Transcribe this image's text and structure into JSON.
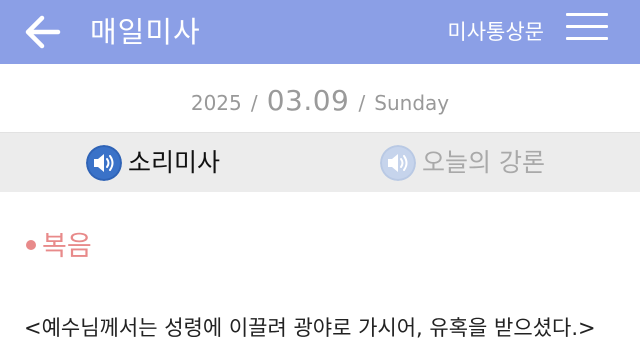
{
  "header": {
    "back_icon": "arrow-left-icon",
    "title": "매일미사",
    "link_label": "미사통상문",
    "menu_icon": "hamburger-menu-icon",
    "background": "#8b9fe6"
  },
  "date": {
    "year": "2025",
    "separator": "/",
    "month_day": "03.09",
    "weekday": "Sunday"
  },
  "tabs": [
    {
      "label": "소리미사",
      "icon": "speaker-icon",
      "active": true,
      "icon_color": "#2f63b6"
    },
    {
      "label": "오늘의 강론",
      "icon": "speaker-icon",
      "active": false,
      "icon_color": "#b9c9e4"
    }
  ],
  "content": {
    "section_title": "복음",
    "section_color": "#e88a8a",
    "body": "<예수님께서는 성령에 이끌려 광야로 가시어, 유혹을 받으셨다.>"
  }
}
